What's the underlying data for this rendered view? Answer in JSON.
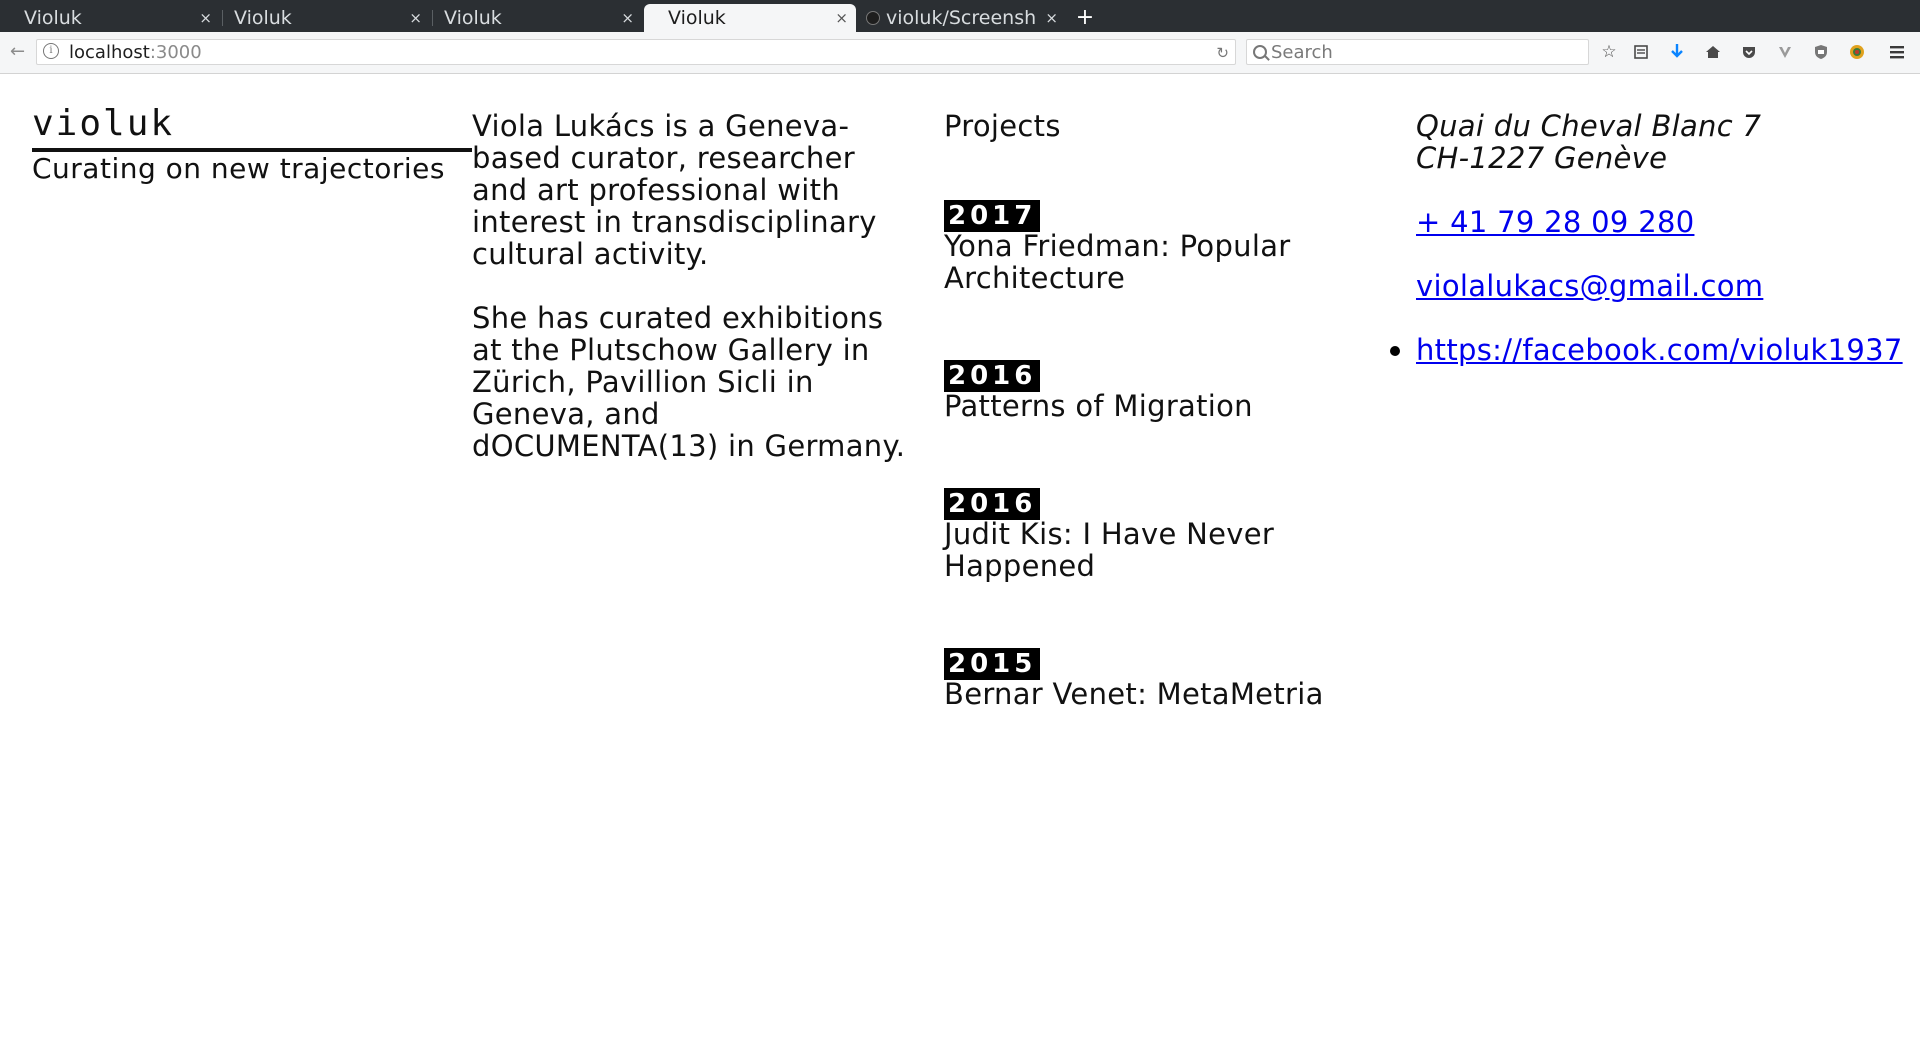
{
  "browser": {
    "tabs": [
      {
        "title": "Violuk",
        "close": "×"
      },
      {
        "title": "Violuk",
        "close": "×"
      },
      {
        "title": "Violuk",
        "close": "×"
      },
      {
        "title": "Violuk",
        "close": "×"
      },
      {
        "title": "violuk/Screenshot",
        "close": "×"
      }
    ],
    "new_tab": "+",
    "url_host": "localhost",
    "url_port": ":3000",
    "search_placeholder": "Search"
  },
  "site": {
    "brand": "violuk",
    "tagline": "Curating on new trajectories",
    "bio": [
      "Viola Lukács is a Geneva-based curator, researcher and art professional with interest in transdisciplinary cultural activity.",
      "She has curated exhibitions at the Plutschow Gallery in Zürich, Pavillion Sicli in Geneva, and dOCUMENTA(13) in Germany."
    ],
    "projects_heading": "Projects",
    "projects": [
      {
        "year": "2017",
        "title": "Yona Friedman: Popular Architecture"
      },
      {
        "year": "2016",
        "title": "Patterns of Migration"
      },
      {
        "year": "2016",
        "title": "Judit Kis: I Have Never Happened"
      },
      {
        "year": "2015",
        "title": "Bernar Venet: MetaMetria"
      }
    ],
    "address": [
      "Quai du Cheval Blanc 7",
      "CH-1227 Genève"
    ],
    "phone": "+ 41 79 28 09 280",
    "email": "violalukacs@gmail.com",
    "social": [
      "https://facebook.com/violuk1937"
    ]
  }
}
